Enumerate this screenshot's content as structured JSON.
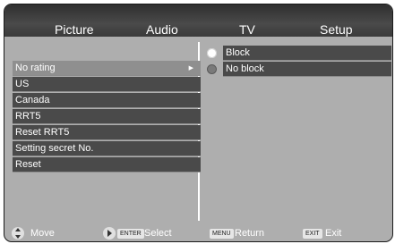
{
  "tabs": [
    "Picture",
    "Audio",
    "TV",
    "Setup"
  ],
  "menu": [
    {
      "label": "No rating",
      "selected": true
    },
    {
      "label": "US"
    },
    {
      "label": "Canada"
    },
    {
      "label": "RRT5"
    },
    {
      "label": "Reset RRT5"
    },
    {
      "label": "Setting secret No."
    },
    {
      "label": "Reset"
    }
  ],
  "options": [
    {
      "label": "Block",
      "state": "on"
    },
    {
      "label": "No block",
      "state": "off"
    }
  ],
  "footer": {
    "move": "Move",
    "enter_key": "ENTER",
    "select": "Select",
    "menu_key": "MENU",
    "return": "Return",
    "exit_key": "EXIT",
    "exit": "Exit"
  },
  "colors": {
    "panel_bg": "#aeaeae",
    "item_bg": "#4a4a4a",
    "selected_bg": "#8f8f8f"
  }
}
